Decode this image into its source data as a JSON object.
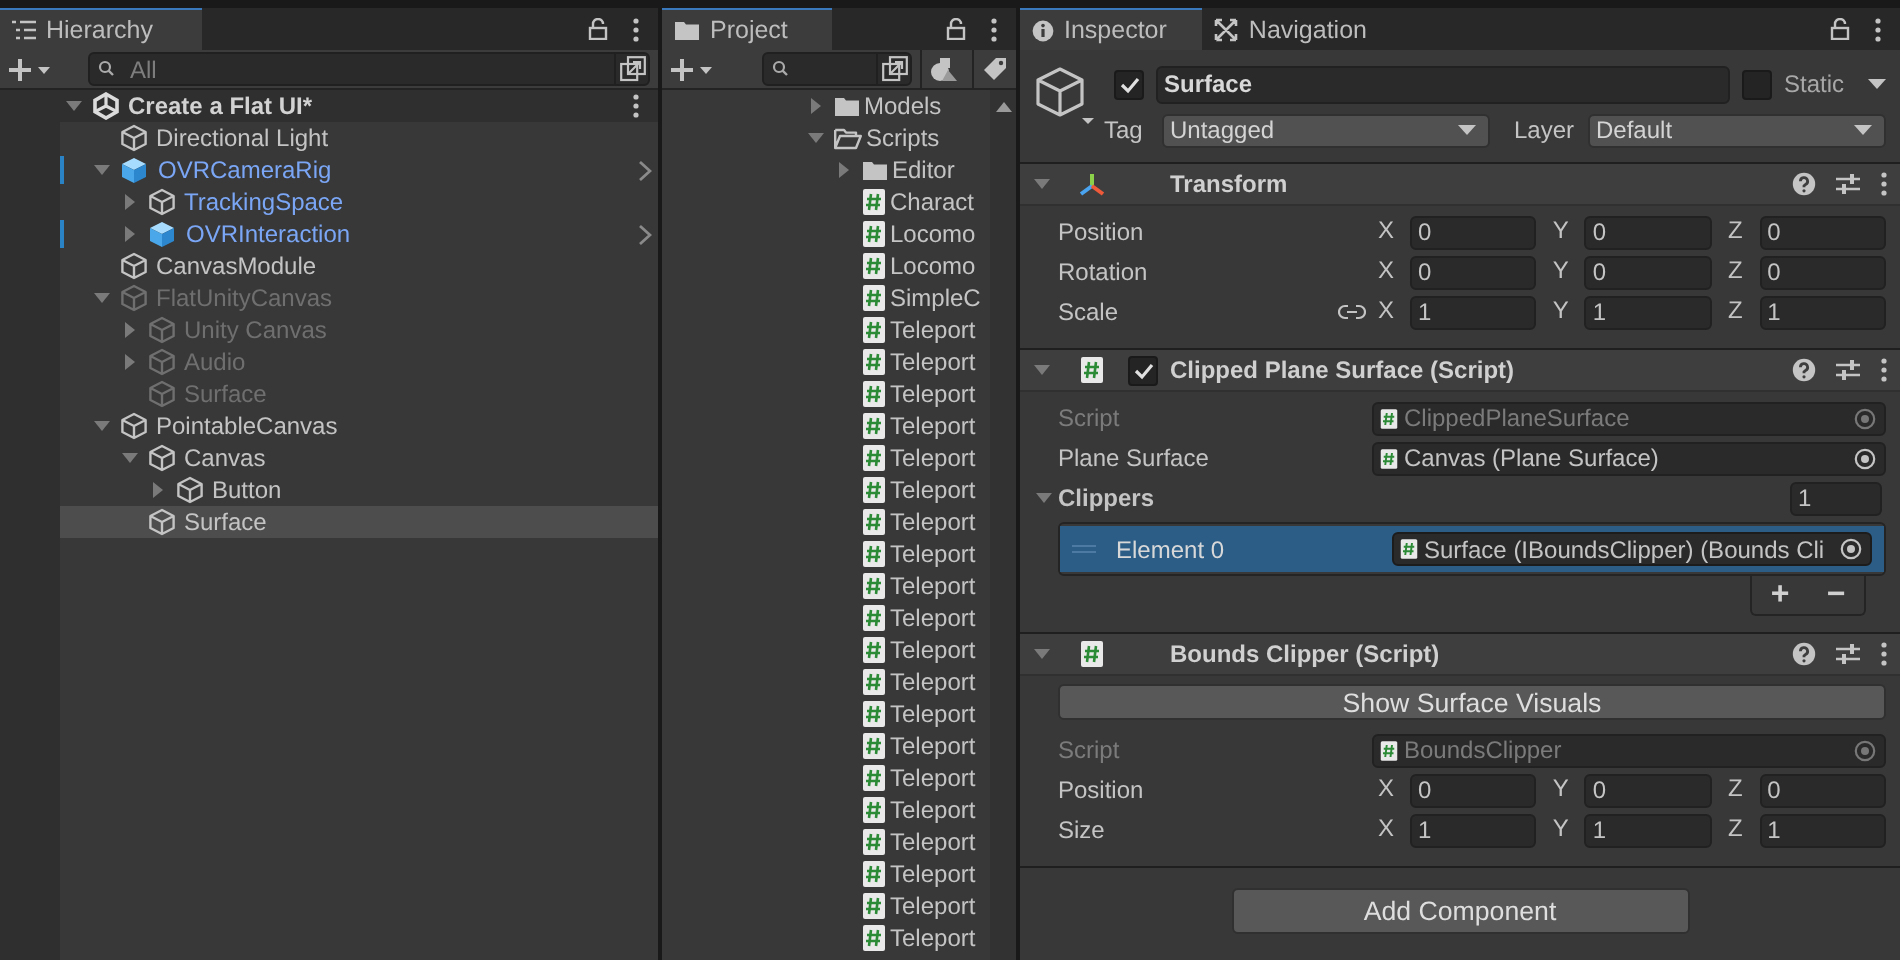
{
  "hierarchy": {
    "tab": "Hierarchy",
    "search": {
      "placeholder": "All"
    },
    "scene": {
      "name": "Create a Flat UI*",
      "expanded": true
    },
    "items": [
      {
        "name": "Directional Light",
        "kind": "object",
        "prefab": false,
        "active": true,
        "overridden": false,
        "prefab_root": false,
        "selected": false
      },
      {
        "name": "OVRCameraRig",
        "kind": "prefab",
        "prefab": true,
        "active": true,
        "expanded": true,
        "overridden": true,
        "prefab_root": true,
        "selected": false,
        "children": [
          {
            "name": "TrackingSpace",
            "kind": "object",
            "prefab": true,
            "active": true,
            "expanded": false,
            "overridden": false,
            "prefab_root": false,
            "selected": false
          },
          {
            "name": "OVRInteraction",
            "kind": "added-prefab",
            "prefab": true,
            "active": true,
            "expanded": false,
            "overridden": true,
            "prefab_root": true,
            "selected": false
          }
        ]
      },
      {
        "name": "CanvasModule",
        "kind": "object",
        "prefab": false,
        "active": true,
        "overridden": false,
        "prefab_root": false,
        "selected": false
      },
      {
        "name": "FlatUnityCanvas",
        "kind": "object",
        "prefab": false,
        "active": false,
        "expanded": true,
        "overridden": false,
        "prefab_root": false,
        "selected": false,
        "children": [
          {
            "name": "Unity Canvas",
            "kind": "object",
            "prefab": false,
            "active": false,
            "expanded": false,
            "overridden": false,
            "prefab_root": false,
            "selected": false
          },
          {
            "name": "Audio",
            "kind": "object",
            "prefab": false,
            "active": false,
            "expanded": false,
            "overridden": false,
            "prefab_root": false,
            "selected": false
          },
          {
            "name": "Surface",
            "kind": "object",
            "prefab": false,
            "active": false,
            "overridden": false,
            "prefab_root": false,
            "selected": false
          }
        ]
      },
      {
        "name": "PointableCanvas",
        "kind": "object",
        "prefab": false,
        "active": true,
        "expanded": true,
        "overridden": false,
        "prefab_root": false,
        "selected": false,
        "children": [
          {
            "name": "Canvas",
            "kind": "object",
            "prefab": false,
            "active": true,
            "expanded": true,
            "overridden": false,
            "prefab_root": false,
            "selected": false,
            "children": [
              {
                "name": "Button",
                "kind": "object",
                "prefab": false,
                "active": true,
                "expanded": false,
                "overridden": false,
                "prefab_root": false,
                "selected": false
              }
            ]
          },
          {
            "name": "Surface",
            "kind": "object",
            "prefab": false,
            "active": true,
            "overridden": false,
            "prefab_root": false,
            "selected": true
          }
        ]
      }
    ]
  },
  "project": {
    "tab": "Project",
    "items": [
      {
        "name": "Models",
        "kind": "folder",
        "expanded": false
      },
      {
        "name": "Scripts",
        "kind": "folder",
        "expanded": true,
        "children": [
          {
            "name": "Editor",
            "kind": "folder",
            "expanded": false
          },
          {
            "name": "Charact",
            "kind": "script"
          },
          {
            "name": "Locomo",
            "kind": "script"
          },
          {
            "name": "Locomo",
            "kind": "script"
          },
          {
            "name": "SimpleC",
            "kind": "script"
          },
          {
            "name": "Teleport",
            "kind": "script"
          },
          {
            "name": "Teleport",
            "kind": "script"
          },
          {
            "name": "Teleport",
            "kind": "script"
          },
          {
            "name": "Teleport",
            "kind": "script"
          },
          {
            "name": "Teleport",
            "kind": "script"
          },
          {
            "name": "Teleport",
            "kind": "script"
          },
          {
            "name": "Teleport",
            "kind": "script"
          },
          {
            "name": "Teleport",
            "kind": "script"
          },
          {
            "name": "Teleport",
            "kind": "script"
          },
          {
            "name": "Teleport",
            "kind": "script"
          },
          {
            "name": "Teleport",
            "kind": "script"
          },
          {
            "name": "Teleport",
            "kind": "script"
          },
          {
            "name": "Teleport",
            "kind": "script"
          },
          {
            "name": "Teleport",
            "kind": "script"
          },
          {
            "name": "Teleport",
            "kind": "script"
          },
          {
            "name": "Teleport",
            "kind": "script"
          },
          {
            "name": "Teleport",
            "kind": "script"
          },
          {
            "name": "Teleport",
            "kind": "script"
          },
          {
            "name": "Teleport",
            "kind": "script"
          },
          {
            "name": "Teleport",
            "kind": "script"
          }
        ]
      }
    ]
  },
  "inspector": {
    "tabs": [
      {
        "label": "Inspector",
        "selected": true
      },
      {
        "label": "Navigation",
        "selected": false
      }
    ],
    "object": {
      "active": true,
      "name": "Surface",
      "static": false,
      "static_label": "Static",
      "tag_label": "Tag",
      "tag": "Untagged",
      "layer_label": "Layer",
      "layer": "Default"
    },
    "components": [
      {
        "kind": "transform",
        "title": "Transform",
        "expanded": true,
        "rows": [
          {
            "kind": "vector3",
            "label": "Position",
            "values": [
              {
                "axis": "X",
                "value": "0"
              },
              {
                "axis": "Y",
                "value": "0"
              },
              {
                "axis": "Z",
                "value": "0"
              }
            ]
          },
          {
            "kind": "vector3",
            "label": "Rotation",
            "values": [
              {
                "axis": "X",
                "value": "0"
              },
              {
                "axis": "Y",
                "value": "0"
              },
              {
                "axis": "Z",
                "value": "0"
              }
            ]
          },
          {
            "kind": "vector3",
            "label": "Scale",
            "constrained": false,
            "values": [
              {
                "axis": "X",
                "value": "1"
              },
              {
                "axis": "Y",
                "value": "1"
              },
              {
                "axis": "Z",
                "value": "1"
              }
            ]
          }
        ]
      },
      {
        "kind": "script",
        "title": "Clipped Plane Surface (Script)",
        "expanded": true,
        "enabled": true,
        "rows": [
          {
            "kind": "object",
            "label": "Script",
            "value": "ClippedPlaneSurface",
            "disabled": true
          },
          {
            "kind": "object",
            "label": "Plane Surface",
            "value": "Canvas (Plane Surface)",
            "disabled": false
          },
          {
            "kind": "list",
            "label": "Clippers",
            "count": "1",
            "expanded": true,
            "add_label": "+",
            "remove_label": "−",
            "elements": [
              {
                "label": "Element 0",
                "value": "Surface (IBoundsClipper) (Bounds Cli",
                "selected": true
              }
            ]
          }
        ]
      },
      {
        "kind": "script",
        "title": "Bounds Clipper (Script)",
        "expanded": true,
        "rows": [
          {
            "kind": "button",
            "label": "Show Surface Visuals"
          },
          {
            "kind": "object",
            "label": "Script",
            "value": "BoundsClipper",
            "disabled": true
          },
          {
            "kind": "vector3",
            "label": "Position",
            "values": [
              {
                "axis": "X",
                "value": "0"
              },
              {
                "axis": "Y",
                "value": "0"
              },
              {
                "axis": "Z",
                "value": "0"
              }
            ]
          },
          {
            "kind": "vector3",
            "label": "Size",
            "values": [
              {
                "axis": "X",
                "value": "1"
              },
              {
                "axis": "Y",
                "value": "1"
              },
              {
                "axis": "Z",
                "value": "1"
              }
            ]
          }
        ]
      }
    ],
    "add_button": "Add Component"
  }
}
